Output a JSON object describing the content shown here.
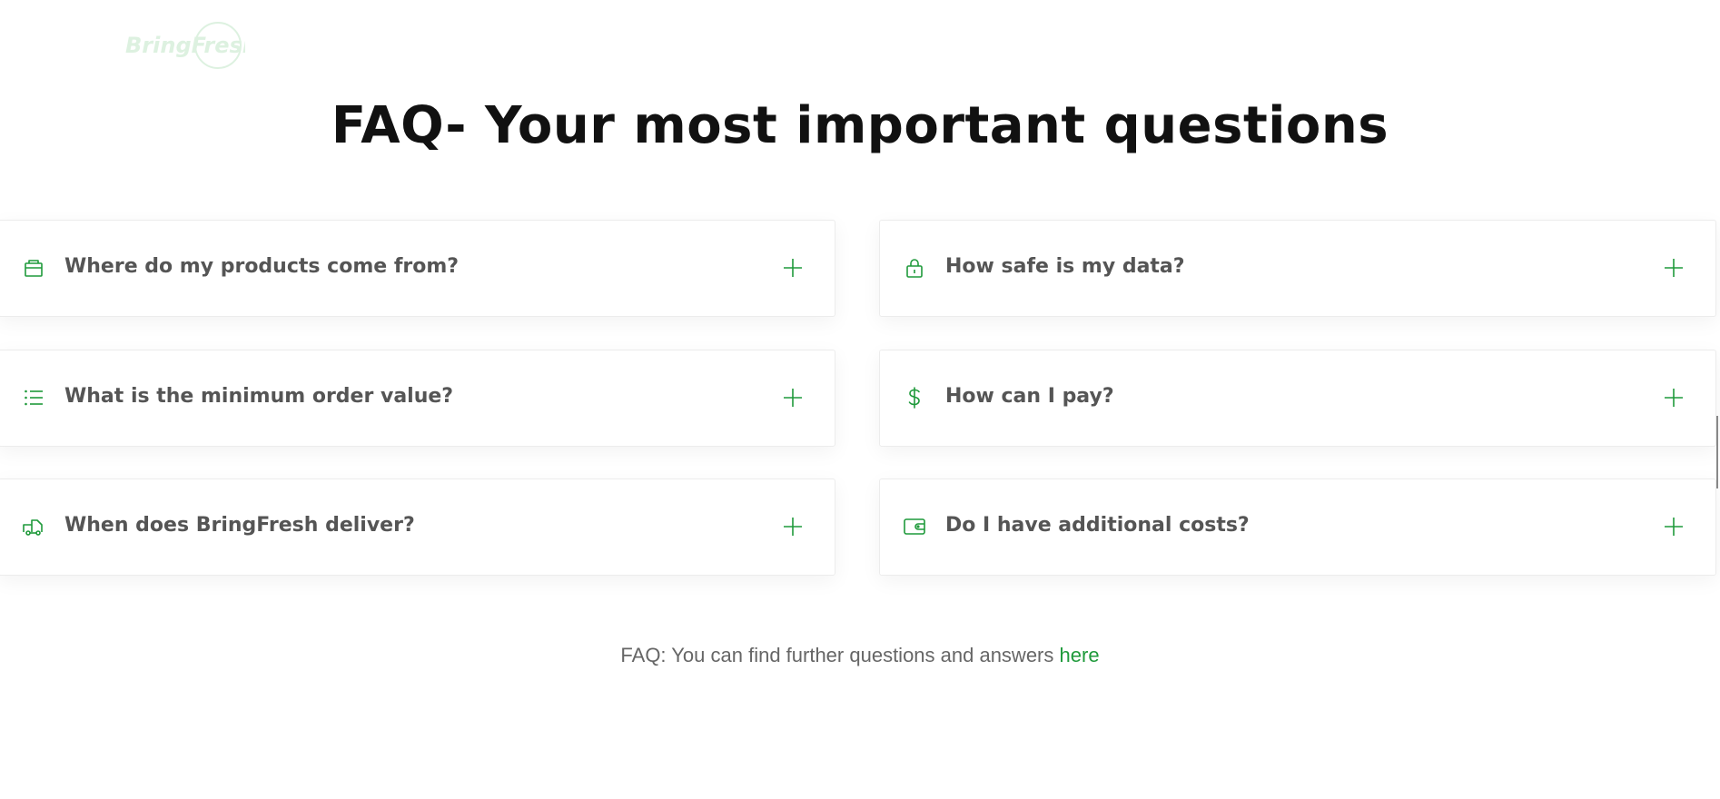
{
  "brand": {
    "logo_text": "BringFresh",
    "accent_color": "#1f9a3b"
  },
  "page": {
    "title": "FAQ- Your most important questions"
  },
  "faq": {
    "items": [
      {
        "question": "Where do my products come from?",
        "icon": "shopping-bag-icon"
      },
      {
        "question": "How safe is my data?",
        "icon": "lock-icon"
      },
      {
        "question": "What is the minimum order value?",
        "icon": "list-icon"
      },
      {
        "question": "How can I pay?",
        "icon": "dollar-icon"
      },
      {
        "question": "When does BringFresh deliver?",
        "icon": "truck-icon"
      },
      {
        "question": "Do I have additional costs?",
        "icon": "wallet-icon"
      }
    ],
    "expand_icon": "plus-icon"
  },
  "footer": {
    "text": "FAQ: You can find further questions and answers",
    "link_label": "here"
  }
}
